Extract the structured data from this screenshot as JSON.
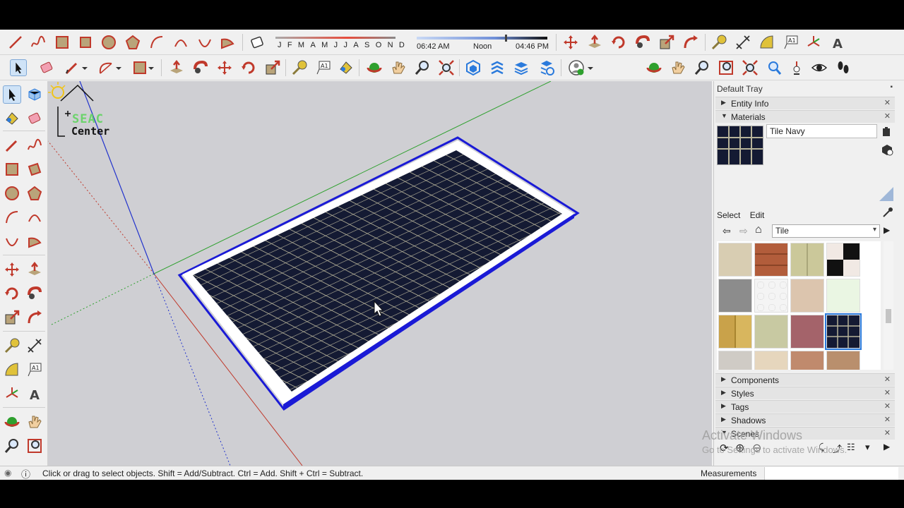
{
  "shadow_bar": {
    "months": [
      "J",
      "F",
      "M",
      "A",
      "M",
      "J",
      "J",
      "A",
      "S",
      "O",
      "N",
      "D"
    ],
    "start_time": "06:42 AM",
    "mid_time": "Noon",
    "end_time": "04:46 PM"
  },
  "logo": {
    "line1": "SEAC",
    "line2": "Center"
  },
  "tray": {
    "title": "Default Tray",
    "entity_info": "Entity Info",
    "materials": "Materials",
    "material_name": "Tile Navy",
    "tab_select": "Select",
    "tab_edit": "Edit",
    "category": "Tile",
    "components": "Components",
    "styles": "Styles",
    "tags": "Tags",
    "shadows": "Shadows",
    "scenes": "Scenes"
  },
  "watermark": {
    "line1": "Activate Windows",
    "line2": "Go to Settings to activate Windows."
  },
  "status": {
    "text": "Click or drag to select objects. Shift = Add/Subtract. Ctrl = Add. Shift + Ctrl = Subtract.",
    "measurements_label": "Measurements"
  },
  "colors": {
    "viewport_bg": "#cfcfd3",
    "tile_navy": "#141a33",
    "grout": "#b8b49a",
    "selection_blue": "#1a1ad6",
    "axis_red": "#c0392b",
    "axis_green": "#2ea02e",
    "axis_blue": "#2233cc"
  }
}
